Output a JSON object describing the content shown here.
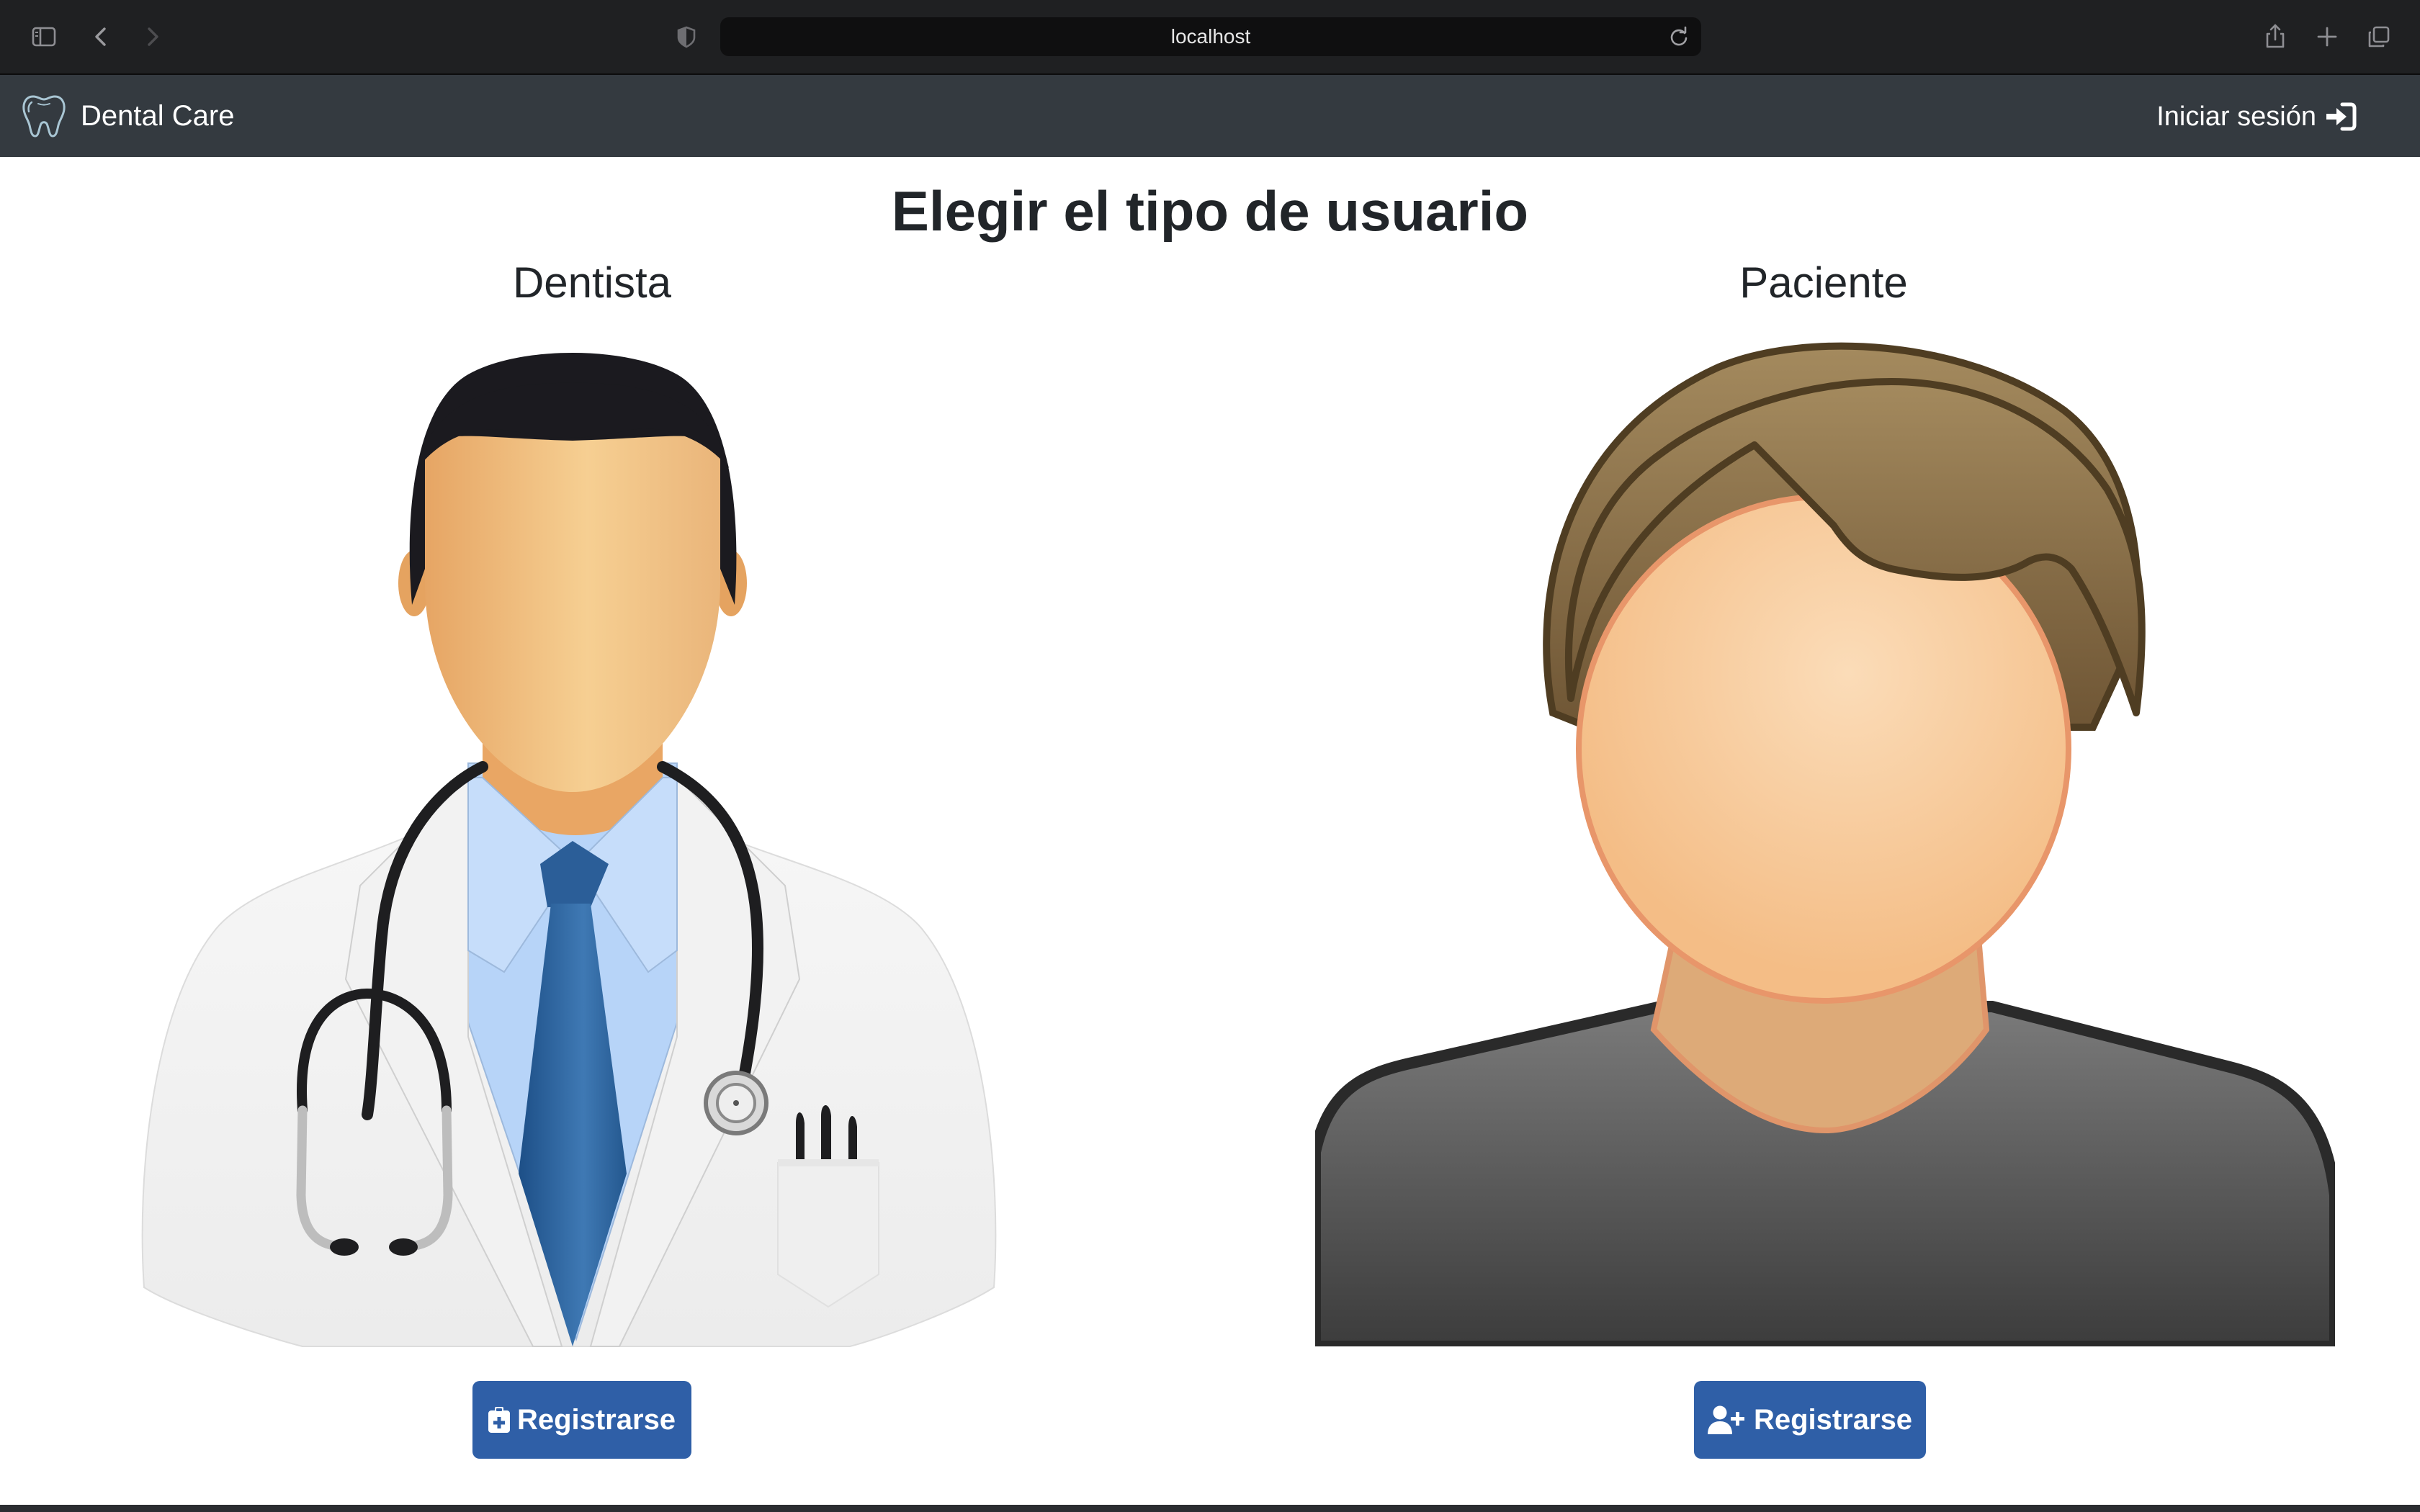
{
  "browser": {
    "url": "localhost",
    "icons": [
      "sidebar-icon",
      "back-icon",
      "forward-icon",
      "privacy-shield-icon",
      "reload-icon",
      "share-icon",
      "new-tab-icon",
      "tab-overview-icon"
    ]
  },
  "navbar": {
    "brand_name": "Dental Care",
    "brand_icon": "tooth-icon",
    "login_label": "Iniciar sesión",
    "login_icon": "sign-in-icon",
    "background": "#343a40"
  },
  "main": {
    "title": "Elegir el tipo de usuario",
    "options": [
      {
        "heading": "Dentista",
        "illustration": "dentist-avatar",
        "button_label": "Registrarse",
        "button_icon": "clipboard-plus-icon"
      },
      {
        "heading": "Paciente",
        "illustration": "patient-avatar",
        "button_label": "Registrarse",
        "button_icon": "user-plus-icon"
      }
    ]
  },
  "colors": {
    "primary_button": "#2f5fa7",
    "text": "#212529"
  }
}
